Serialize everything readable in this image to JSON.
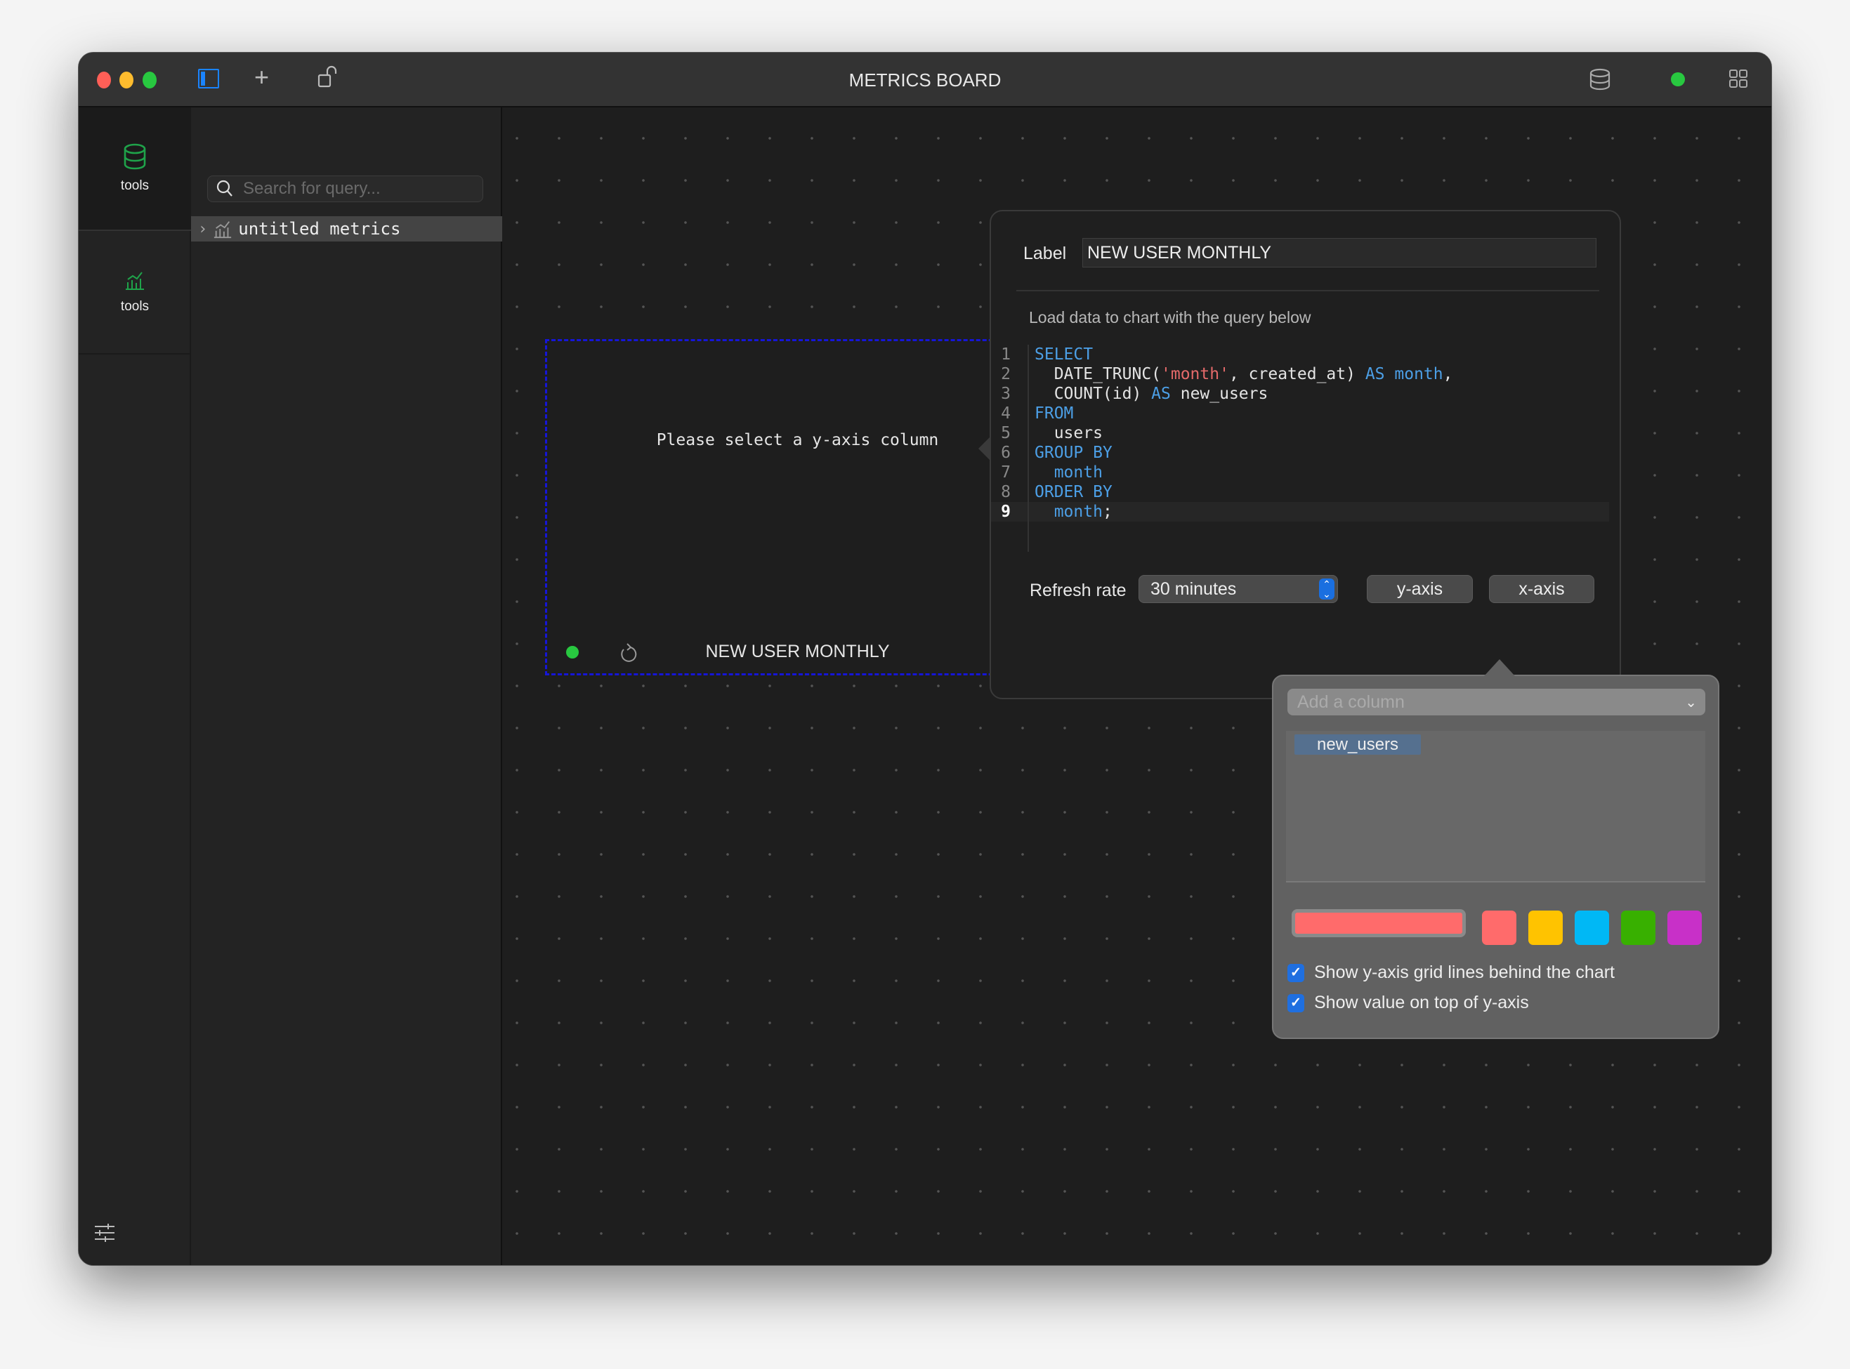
{
  "window": {
    "title": "METRICS BOARD",
    "status_color": "#28c840"
  },
  "rail": {
    "items": [
      {
        "label": "tools",
        "icon": "database-icon"
      },
      {
        "label": "tools",
        "icon": "chart-icon"
      }
    ]
  },
  "sidebar": {
    "search_placeholder": "Search for query...",
    "tree": [
      {
        "label": "untitled metrics",
        "icon": "chart-icon"
      }
    ]
  },
  "card": {
    "message": "Please select a y-axis column",
    "title": "NEW USER MONTHLY",
    "status_color": "#28c840"
  },
  "editor": {
    "label_caption": "Label",
    "label_value": "NEW USER MONTHLY",
    "hint": "Load data to chart with the query below",
    "code": [
      [
        {
          "t": "kw",
          "v": "SELECT"
        }
      ],
      [
        {
          "t": "tx",
          "v": "  DATE_TRUNC("
        },
        {
          "t": "str",
          "v": "'month'"
        },
        {
          "t": "tx",
          "v": ", created_at) "
        },
        {
          "t": "kw",
          "v": "AS month"
        },
        {
          "t": "tx",
          "v": ","
        }
      ],
      [
        {
          "t": "tx",
          "v": "  COUNT(id) "
        },
        {
          "t": "kw",
          "v": "AS"
        },
        {
          "t": "tx",
          "v": " new_users"
        }
      ],
      [
        {
          "t": "kw",
          "v": "FROM"
        }
      ],
      [
        {
          "t": "tx",
          "v": "  users"
        }
      ],
      [
        {
          "t": "kw",
          "v": "GROUP BY"
        }
      ],
      [
        {
          "t": "kw",
          "v": "  month"
        }
      ],
      [
        {
          "t": "kw",
          "v": "ORDER BY"
        }
      ],
      [
        {
          "t": "kw",
          "v": "  month"
        },
        {
          "t": "tx",
          "v": ";"
        }
      ]
    ],
    "refresh_label": "Refresh rate",
    "refresh_value": "30 minutes",
    "yaxis_label": "y-axis",
    "xaxis_label": "x-axis"
  },
  "yaxis_panel": {
    "column_placeholder": "Add a column",
    "columns": [
      "new_users"
    ],
    "selected_color": "#ff6b6b",
    "colors": [
      "#ff6b6b",
      "#ffc300",
      "#00b8f5",
      "#38b000",
      "#c830c8"
    ],
    "options": [
      {
        "label": "Show y-axis grid lines behind the chart",
        "checked": true
      },
      {
        "label": "Show value on top of y-axis",
        "checked": true
      }
    ]
  }
}
